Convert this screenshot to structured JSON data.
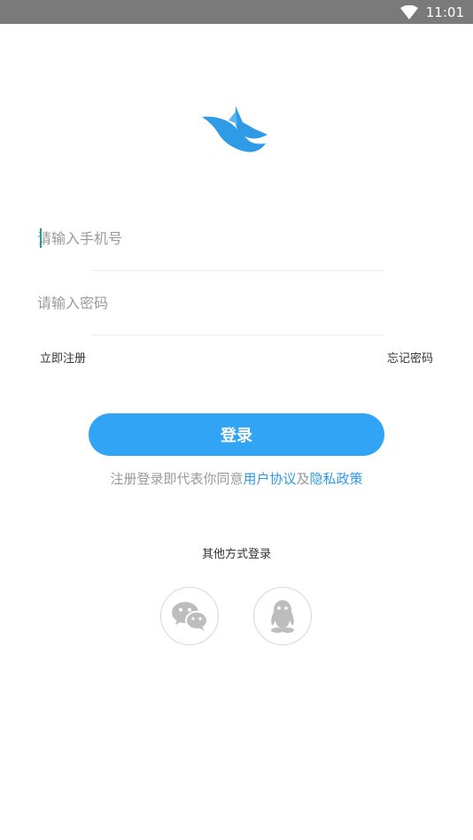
{
  "status_bar": {
    "time": "11:01",
    "wifi_icon": "wifi-icon"
  },
  "app": {
    "logo_icon": "bird-logo-icon",
    "brand_color": "#31a4f5"
  },
  "form": {
    "phone_placeholder": "请输入手机号",
    "password_placeholder": "请输入密码",
    "register_label": "立即注册",
    "forgot_label": "忘记密码",
    "login_label": "登录"
  },
  "agreement": {
    "prefix": "注册登录即代表你同意",
    "user_agreement": "用户协议",
    "and": "及",
    "privacy_policy": "隐私政策"
  },
  "other_login": {
    "title": "其他方式登录",
    "options": [
      {
        "name": "wechat",
        "icon": "wechat-icon"
      },
      {
        "name": "qq",
        "icon": "qq-icon"
      }
    ]
  }
}
